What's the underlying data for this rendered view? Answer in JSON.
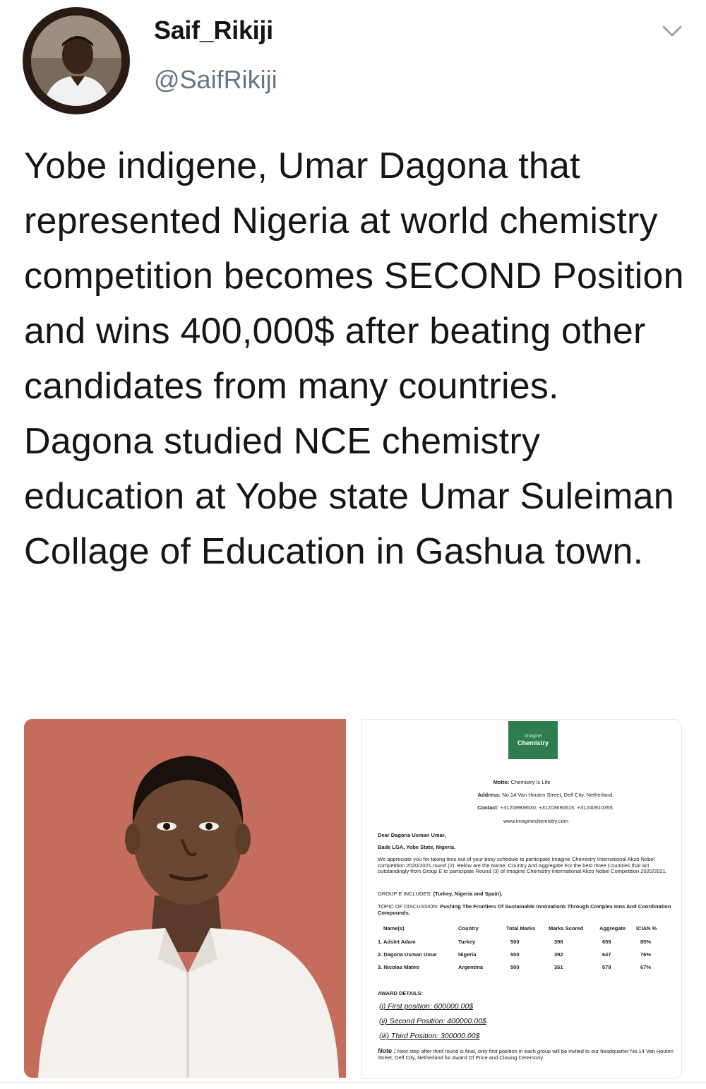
{
  "tweet": {
    "display_name": "Saif_Rikiji",
    "handle": "@SaifRikiji",
    "text": "Yobe indigene, Umar Dagona that represented Nigeria at world chemistry competition becomes SECOND Position and wins 400,000$ after beating other candidates from many countries. Dagona studied NCE chemistry education at Yobe state Umar Suleiman Collage of Education in Gashua town."
  },
  "icons": {
    "menu": "chevron-down-icon",
    "avatar": "avatar"
  },
  "colors": {
    "text": "#14171a",
    "secondary": "#657786",
    "photo_background": "#c96f62",
    "logo_green": "#2e7d4f"
  },
  "document": {
    "logo_line1": "Imagine",
    "logo_line2": "Chemistry",
    "motto_label": "Motto:",
    "motto": "Chemistry Is Life",
    "address_label": "Address:",
    "address": "No.14 Van Houten Street, Delf City, Netherland.",
    "contact_label": "Contact:",
    "contact": "+31208909530, +31203690615, +31240910355.",
    "website": "www.imaginechemistry.com",
    "salutation": "Dear Dagona Usman Umar,",
    "location": "Bade LGA, Yobe State, Nigeria.",
    "body": "We appreciate you for taking time out of your busy schedule to participate Imagine Chemistry International Akzo Nobel competition 2020/2021 round (2). Below are the Name, Country And Aggregate For the best three Countries that act outstandingly from Group E to participate Round (3) of Imagine Chemistry International Akzo Nobel Competition 2020/2021.",
    "group_label": "GROUP E INCLUDES:",
    "group_value": "(Turkey, Nigeria and Spain).",
    "topic_label": "TOPIC OF DISCUSSION:",
    "topic_value": "Pushing The Frontiers Of Sustainable Innovations Through Complex Ions And Coordination Compounds.",
    "table_headers": [
      "Name(s)",
      "Country",
      "Total Marks",
      "Marks Scored",
      "Aggregate",
      "ICIAN %"
    ],
    "table_rows": [
      [
        "1. Adslet Adam",
        "Turkey",
        "500",
        "398",
        "659",
        "85%"
      ],
      [
        "2. Dagona Usman Umar",
        "Nigeria",
        "500",
        "392",
        "647",
        "76%"
      ],
      [
        "3. Nicolas Mateo",
        "Argentina",
        "500",
        "351",
        "579",
        "67%"
      ]
    ],
    "award_heading": "AWARD DETAILS:",
    "awards": [
      "(i)   First position:      600000.00$",
      "(ii)   Second Position:   400000.00$",
      "(iii)  Third Position:     300000.00$"
    ],
    "note_label": "Note :",
    "note": "Next step after third round is final, only first position in each group will be invited to our headquarter No.14 Van Houten Street, Delf City, Netherland for Award Of Price and Closing Ceremony."
  }
}
